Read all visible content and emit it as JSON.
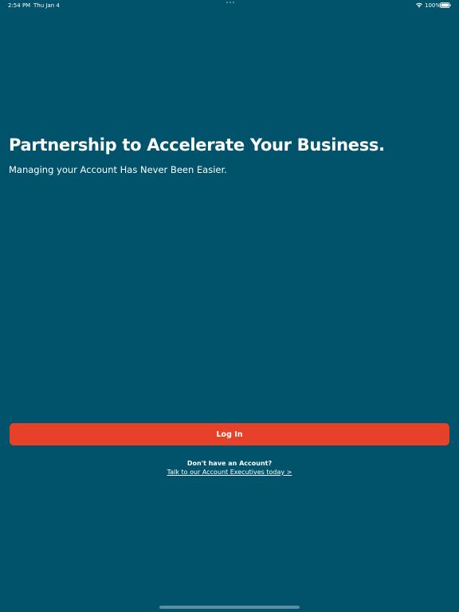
{
  "status_bar": {
    "time": "2:54 PM",
    "date": "Thu Jan 4",
    "battery": "100%",
    "wifi_icon": "wifi-icon",
    "battery_icon": "battery-full-icon"
  },
  "hero": {
    "title": "Partnership to Accelerate Your Business.",
    "subtitle": "Managing your Account Has Never Been Easier."
  },
  "actions": {
    "login_label": "Log In",
    "no_account_text": "Don't have an Account?",
    "contact_link": "Talk to our Account Executives today >"
  },
  "colors": {
    "background": "#00536a",
    "accent": "#e8412a",
    "text": "#ffffff"
  }
}
